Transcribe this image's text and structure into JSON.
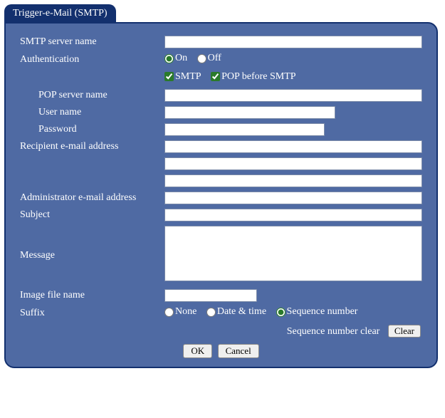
{
  "tab_title": "Trigger-e-Mail (SMTP)",
  "labels": {
    "smtp_server": "SMTP server name",
    "authentication": "Authentication",
    "auth_on": "On",
    "auth_off": "Off",
    "auth_smtp": "SMTP",
    "auth_pop_before_smtp": "POP before SMTP",
    "pop_server": "POP server name",
    "user_name": "User name",
    "password": "Password",
    "recipient": "Recipient e-mail address",
    "admin_addr": "Administrator e-mail address",
    "subject": "Subject",
    "message": "Message",
    "image_file": "Image file name",
    "suffix": "Suffix",
    "suffix_none": "None",
    "suffix_datetime": "Date & time",
    "suffix_seqnum": "Sequence number",
    "seq_clear_label": "Sequence number clear",
    "clear_btn": "Clear",
    "ok_btn": "OK",
    "cancel_btn": "Cancel"
  },
  "values": {
    "smtp_server": "",
    "auth_on": true,
    "auth_smtp": true,
    "auth_pop_before_smtp": true,
    "pop_server": "",
    "user_name": "",
    "password": "",
    "recipient1": "",
    "recipient2": "",
    "recipient3": "",
    "admin_addr": "",
    "subject": "",
    "message": "",
    "image_file": "",
    "suffix": "seqnum"
  }
}
